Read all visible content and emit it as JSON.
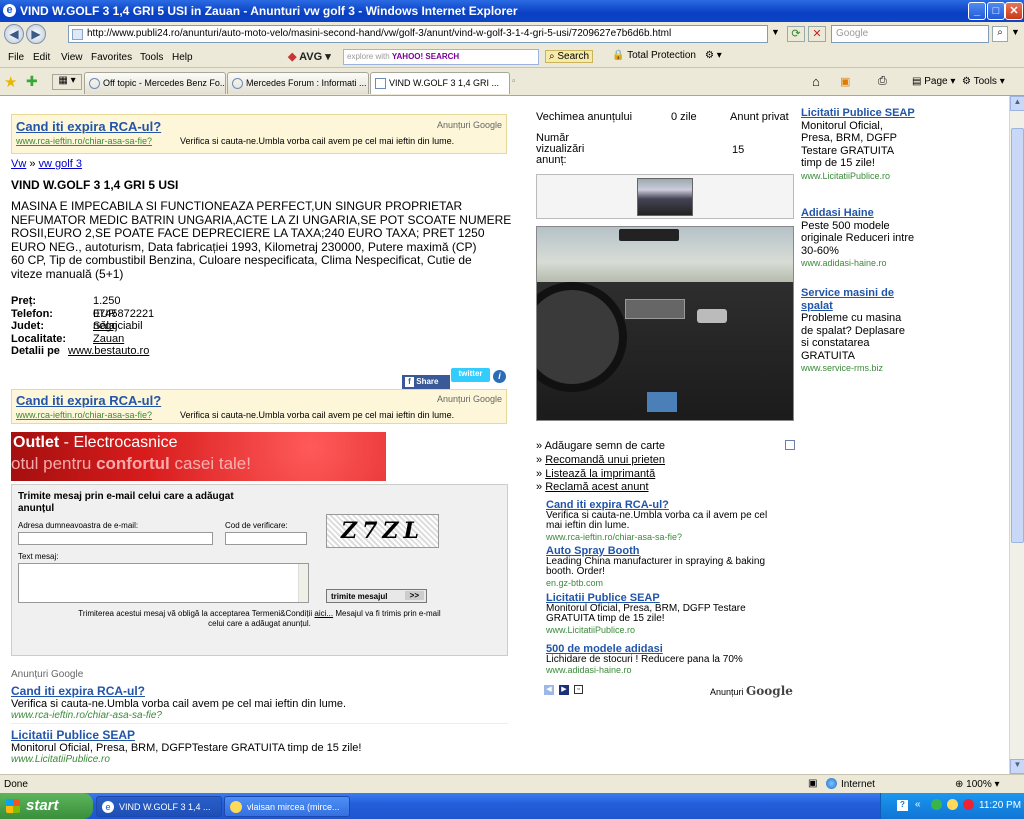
{
  "window": {
    "title": "VIND W.GOLF 3 1,4 GRI 5 USI in Zauan - Anunturi vw golf 3 - Windows Internet Explorer",
    "min": "_",
    "max": "□",
    "close": "✕"
  },
  "address": {
    "url": "http://www.publi24.ro/anunturi/auto-moto-velo/masini-second-hand/vw/golf-3/anunt/vind-w-golf-3-1-4-gri-5-usi/7209627e7b6d6b.html",
    "search_placeholder": "Google"
  },
  "menu": [
    "File",
    "Edit",
    "View",
    "Favorites",
    "Tools",
    "Help"
  ],
  "toolbar": {
    "avg": "AVG",
    "yahoo_search_placeholder": "explore with",
    "yahoo_logo": "YAHOO! SEARCH",
    "search_button": "Search",
    "total_protection": "Total Protection"
  },
  "tabs": [
    {
      "label": "Off topic - Mercedes Benz Fo..."
    },
    {
      "label": "Mercedes Forum : Informati ..."
    },
    {
      "label": "VIND W.GOLF 3 1,4 GRI ..."
    }
  ],
  "ie_tools": {
    "page": "Page",
    "tools": "Tools"
  },
  "top_ad": {
    "title": "Cand iti expira RCA-ul?",
    "url": "www.rca-ieftin.ro/chiar-asa-sa-fie?",
    "desc": "Verifica si cauta-ne.Umbla vorba cail avem pe cel mai ieftin din lume.",
    "label": "Anunțuri Google"
  },
  "breadcrumb": {
    "first": "Vw",
    "sep": "»",
    "second": "vw golf 3"
  },
  "listing": {
    "title": "VIND W.GOLF 3 1,4 GRI 5 USI",
    "description_lines": [
      "MASINA E IMPECABILA SI FUNCTIONEAZA PERFECT,UN SINGUR PROPRIETAR",
      "NEFUMATOR MEDIC BATRIN UNGARIA,ACTE LA ZI UNGARIA,SE POT SCOATE NUMERE",
      "ROSII,EURO 2,SE POATE FACE DEPRECIERE LA TAXA;240 EURO TAXA; PRET 1250",
      "EURO NEG., autoturism, Data fabricației 1993, Kilometraj 230000, Putere maximă (CP)",
      "60 CP, Tip de combustibil Benzina, Culoare nespecificata, Clima Nespecificat, Cutie de",
      "viteze manuală (5+1)"
    ],
    "details": [
      {
        "label": "Preț:",
        "value": "1.250 EUR negociabil"
      },
      {
        "label": "Telefon:",
        "value": "0745872221"
      },
      {
        "label": "Judet:",
        "value": "Sălaj"
      },
      {
        "label": "Localitate:",
        "value": "Zauan"
      },
      {
        "label": "Detalii pe",
        "value": "www.bestauto.ro"
      }
    ],
    "share": "Share",
    "twitter": "twitter"
  },
  "mid_ad": {
    "title": "Cand iti expira RCA-ul?",
    "url": "www.rca-ieftin.ro/chiar-asa-sa-fie?",
    "desc": "Verifica si cauta-ne.Umbla vorba cail avem pe cel mai ieftin din lume.",
    "label": "Anunțuri Google"
  },
  "outlet_banner": {
    "line1_bold": "Outlet",
    "line1_rest": " - Electrocasnice",
    "line2_a": "otul pentru ",
    "line2_bold": "confortul",
    "line2_b": " casei tale!",
    "bg_color": "#d81c1c"
  },
  "contact_form": {
    "heading": "Trimite mesaj prin e-mail celui care a adăugat anunțul",
    "email_label": "Adresa dumneavoastra de e-mail:",
    "code_label": "Cod de verificare:",
    "captcha": "Z7ZL",
    "message_label": "Text mesaj:",
    "send_button": "trimite mesajul",
    "send_arrow": ">>",
    "terms_a": "Trimiterea acestui mesaj vă obligă la acceptarea Termeni&Condiții",
    "terms_link": "aici...",
    "terms_b": "Mesajul va fi trimis prin e-mail",
    "terms_c": "celui care a adăugat anunțul."
  },
  "bottom_ads": {
    "label": "Anunțuri Google",
    "items": [
      {
        "title": "Cand iti expira RCA-ul?",
        "desc": "Verifica si cauta-ne.Umbla vorba cail avem pe cel mai ieftin din lume.",
        "url": "www.rca-ieftin.ro/chiar-asa-sa-fie?"
      },
      {
        "title": "Licitatii Publice SEAP",
        "desc": "Monitorul Oficial, Presa, BRM, DGFPTestare GRATUITA timp de 15 zile!",
        "url": "www.LicitatiiPublice.ro"
      }
    ]
  },
  "stats": {
    "age_label": "Vechimea anunțului",
    "age_value": "0 zile",
    "owner": "Anunt privat",
    "views_label_lines": [
      "Număr",
      "vizualizări",
      "anunț:"
    ],
    "views_value": "15"
  },
  "actions": [
    {
      "label": "Adăugare semn de carte",
      "link": false
    },
    {
      "label": "Recomandă unui prieten",
      "link": true
    },
    {
      "label": "Listează la imprimantă",
      "link": true
    },
    {
      "label": "Reclamă acest anunt",
      "link": true
    }
  ],
  "mid_column_ads": {
    "items": [
      {
        "title": "Cand iti expira RCA-ul?",
        "desc": [
          "Verifica si cauta-ne.Umbla vorba ca il avem pe cel",
          "mai ieftin din lume."
        ],
        "url": "www.rca-ieftin.ro/chiar-asa-sa-fie?"
      },
      {
        "title": "Auto Spray Booth",
        "desc": [
          "Leading China manufacturer in spraying & baking",
          "booth. Order!"
        ],
        "url": "en.gz-btb.com"
      },
      {
        "title": "Licitatii Publice SEAP",
        "desc": [
          "Monitorul Oficial, Presa, BRM, DGFP Testare",
          "GRATUITA timp de 15 zile!"
        ],
        "url": "www.LicitatiiPublice.ro"
      },
      {
        "title": "500 de modele adidasi",
        "desc": [
          "Lichidare de stocuri ! Reducere pana la 70%"
        ],
        "url": "www.adidasi-haine.ro"
      }
    ],
    "label": "Anunțuri",
    "google": "Google"
  },
  "right_ads": [
    {
      "title": "Licitatii Publice SEAP",
      "desc": [
        "Monitorul Oficial,",
        "Presa, BRM, DGFP",
        "Testare GRATUITA",
        "timp de 15 zile!"
      ],
      "url": "www.LicitatiiPublice.ro"
    },
    {
      "title": "Adidasi Haine",
      "desc": [
        "Peste 500 modele",
        "originale Reduceri intre",
        "30-60%"
      ],
      "url": "www.adidasi-haine.ro"
    },
    {
      "title": "Service masini de",
      "title2": "spalat",
      "desc": [
        "Probleme cu masina",
        "de spalat? Deplasare",
        "si constatarea",
        "GRATUITA"
      ],
      "url": "www.service-rms.biz"
    }
  ],
  "status": {
    "left": "Done",
    "zone": "Internet",
    "zoom": "100%"
  },
  "taskbar": {
    "start": "start",
    "tasks": [
      "VIND W.GOLF 3 1,4 ...",
      "vlaisan mircea (mirce..."
    ],
    "time": "11:20 PM"
  }
}
